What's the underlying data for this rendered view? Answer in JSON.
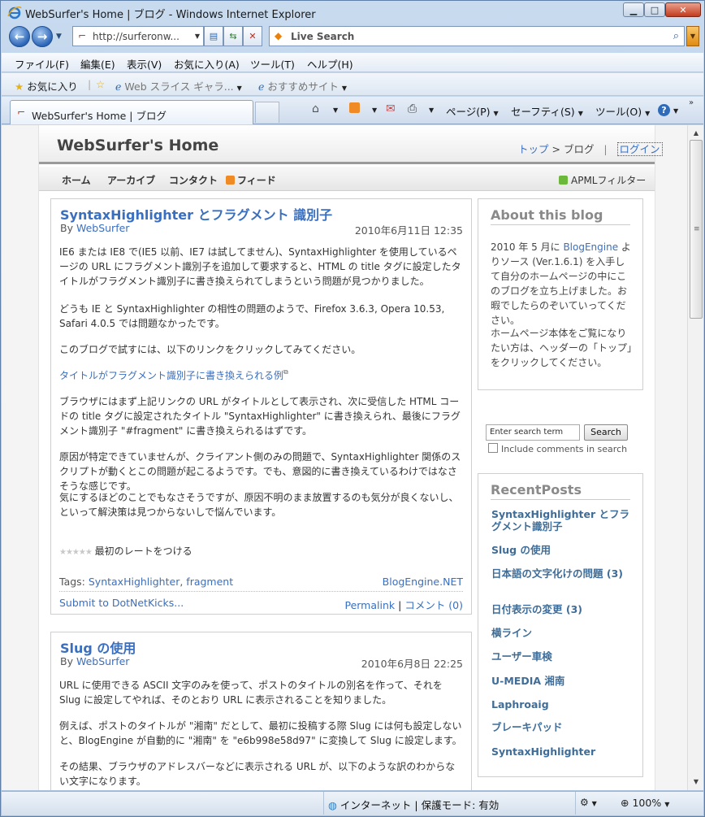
{
  "window": {
    "title": "WebSurfer's Home | ブログ - Windows Internet Explorer",
    "minimize": "▁",
    "maximize": "□",
    "close": "✕"
  },
  "address": {
    "url": "http://surferonw...",
    "search_placeholder": "Live Search"
  },
  "menu": [
    "ファイル(F)",
    "編集(E)",
    "表示(V)",
    "お気に入り(A)",
    "ツール(T)",
    "ヘルプ(H)"
  ],
  "favorites": {
    "label": "お気に入り",
    "webslice": "Web スライス ギャラ...",
    "suggested": "おすすめサイト"
  },
  "tab": {
    "title": "WebSurfer's Home | ブログ"
  },
  "commandbar": {
    "page": "ページ(P)",
    "safety": "セーフティ(S)",
    "tools": "ツール(O)",
    "help": "?"
  },
  "site": {
    "title": "WebSurfer's Home",
    "crumb_top": "トップ",
    "crumb_sep": " > ",
    "crumb_current": "ブログ",
    "crumb_bar": "|",
    "login": "ログイン",
    "nav": [
      "ホーム",
      "アーカイブ",
      "コンタクト",
      "フィード"
    ],
    "apml": "APMLフィルター"
  },
  "post1": {
    "title": "SyntaxHighlighter とフラグメント 識別子",
    "by": "By ",
    "author": "WebSurfer",
    "date": "2010年6月11日 12:35",
    "p1": "IE6 または IE8 で(IE5 以前、IE7 は試してません)、SyntaxHighlighter を使用しているページの URL にフラグメント識別子を追加して要求すると、HTML の title タグに設定したタイトルがフラグメント識別子に書き換えられてしまうという問題が見つかりました。",
    "p2": "どうも IE と SyntaxHighlighter の相性の問題のようで、Firefox 3.6.3, Opera 10.53, Safari 4.0.5 では問題なかったです。",
    "p3": "このブログで試すには、以下のリンクをクリックしてみてください。",
    "link": "タイトルがフラグメント識別子に書き換えられる例",
    "p4": "ブラウザにはまず上記リンクの URL がタイトルとして表示され、次に受信した HTML コードの title タグに設定されたタイトル \"SyntaxHighlighter\" に書き換えられ、最後にフラグメント識別子 \"#fragment\" に書き換えられるはずです。",
    "p5": "原因が特定できていませんが、クライアント側のみの問題で、SyntaxHighlighter 関係のスクリプトが動くとこの問題が起こるようです。でも、意図的に書き換えているわけではなさそうな感じです。",
    "p6": "気にするほどのことでもなさそうですが、原因不明のまま放置するのも気分が良くないし、といって解決策は見つからないしで悩んでいます。",
    "stars": "★★★★★",
    "rate": "最初のレートをつける",
    "tags_label": "Tags: ",
    "tag1": "SyntaxHighlighter",
    "tag_sep": ", ",
    "tag2": "fragment",
    "category": "BlogEngine.NET",
    "kick": "Submit to DotNetKicks...",
    "permalink": "Permalink",
    "sep": " | ",
    "comments": "コメント (0)"
  },
  "post2": {
    "title": "Slug の使用",
    "by": "By ",
    "author": "WebSurfer",
    "date": "2010年6月8日 22:25",
    "p1": "URL に使用できる ASCII 文字のみを使って、ポストのタイトルの別名を作って、それを Slug に設定してやれば、そのとおり URL に表示されることを知りました。",
    "p2": "例えば、ポストのタイトルが \"湘南\" だとして、最初に投稿する際 Slug には何も設定しないと、BlogEngine が自動的に \"湘南\" を \"e6b998e58d97\" に変換して Slug に設定します。",
    "p3": "その結果、ブラウザのアドレスバーなどに表示される URL が、以下のような訳のわからない文字になります。"
  },
  "about": {
    "title": "About this blog",
    "p1a": "2010 年 5 月に ",
    "p1link": "BlogEngine",
    "p1b": " よりソース (Ver.1.6.1) を入手して自分のホームページの中にこのブログを立ち上げました。お暇でしたらのぞいていってください。",
    "p2": "ホームページ本体をご覧になりたい方は、ヘッダーの「トップ」をクリックしてください。"
  },
  "sidebar_search": {
    "value": "Enter search term",
    "button": "Search",
    "include": "Include comments in search"
  },
  "recent": {
    "title": "RecentPosts",
    "items": [
      "SyntaxHighlighter とフラグメント識別子",
      "Slug の使用",
      "日本語の文字化けの問題 (3)",
      "日付表示の変更 (3)",
      "横ライン",
      "ユーザー車検",
      "U-MEDIA 湘南",
      "Laphroaig",
      "ブレーキパッド",
      "SyntaxHighlighter"
    ]
  },
  "status": {
    "zone": "インターネット | 保護モード: 有効",
    "zoom": "100%"
  }
}
